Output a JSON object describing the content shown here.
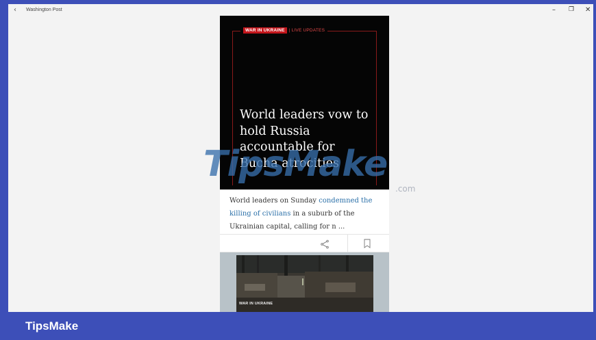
{
  "window": {
    "title": "Washington Post",
    "back_glyph": "‹",
    "minimize_glyph": "–",
    "maximize_glyph": "❐",
    "close_glyph": "✕"
  },
  "article": {
    "tag_section": "WAR IN UKRAINE",
    "tag_live": "| LIVE UPDATES",
    "headline": "World leaders vow to hold Russia accountable for Bucha atrocities",
    "summary_start": "World leaders on Sunday ",
    "summary_link": "condemned the killing of civilians",
    "summary_end": " in a suburb of the Ukrainian capital, calling for n ...",
    "share_icon": "share-icon",
    "bookmark_icon": "bookmark-icon"
  },
  "next_story": {
    "tag": "WAR IN UKRAINE"
  },
  "watermark": {
    "text": "TipsMake",
    "suffix": ".com"
  },
  "footer": {
    "brand": "TipsMake"
  },
  "colors": {
    "frame": "#3d4fb8",
    "window_bg": "#f3f3f3",
    "hero_bg": "#050505",
    "tag_red": "#c4161c",
    "link_blue": "#2a6fa8"
  }
}
